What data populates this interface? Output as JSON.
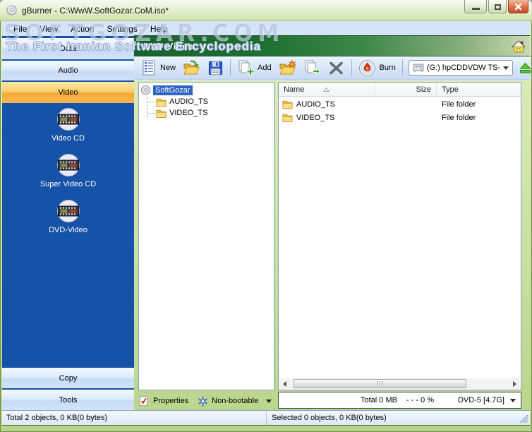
{
  "window": {
    "title": "gBurner - C:\\WwW.SoftGozar.CoM.iso*"
  },
  "menu": {
    "items": [
      "File",
      "View",
      "Action",
      "Settings",
      "Help"
    ]
  },
  "watermark": {
    "title": "SOFTGOZAR.COM",
    "subtitle": "The First Iranian Software Encyclopedia"
  },
  "sidebar": {
    "sections": [
      {
        "label": "Data"
      },
      {
        "label": "Audio"
      },
      {
        "label": "Video"
      },
      {
        "label": "Copy"
      },
      {
        "label": "Tools"
      }
    ],
    "selected_section": "Video",
    "video_items": [
      {
        "label": "Video CD"
      },
      {
        "label": "Super Video CD"
      },
      {
        "label": "DVD-Video"
      }
    ]
  },
  "header": {
    "title": "DVD-Video"
  },
  "toolbar": {
    "new_label": "New",
    "add_label": "Add",
    "burn_label": "Burn",
    "drive_value": "(G:) hpCDDVDW TS-"
  },
  "tree": {
    "root_label": "SoftGozar",
    "children": [
      {
        "label": "AUDIO_TS"
      },
      {
        "label": "VIDEO_TS"
      }
    ]
  },
  "file_list": {
    "columns": {
      "name": "Name",
      "size": "Size",
      "type": "Type"
    },
    "rows": [
      {
        "name": "AUDIO_TS",
        "size": "",
        "type": "File folder"
      },
      {
        "name": "VIDEO_TS",
        "size": "",
        "type": "File folder"
      }
    ]
  },
  "footer": {
    "properties_label": "Properties",
    "boot_mode_label": "Non-bootable"
  },
  "capacity": {
    "total_label": "Total  0 MB",
    "percent_label": "- - -  0 %",
    "media_label": "DVD-5 [4.7G]"
  },
  "status": {
    "left": "Total 2 objects, 0 KB(0 bytes)",
    "right": "Selected 0 objects, 0 KB(0 bytes)"
  },
  "colors": {
    "header_green": "#16642a",
    "sidebar_blue": "#1552a8",
    "selection_blue": "#2e63c4",
    "selected_tab_orange": "#f4a938",
    "close_red": "#c24a2a"
  }
}
